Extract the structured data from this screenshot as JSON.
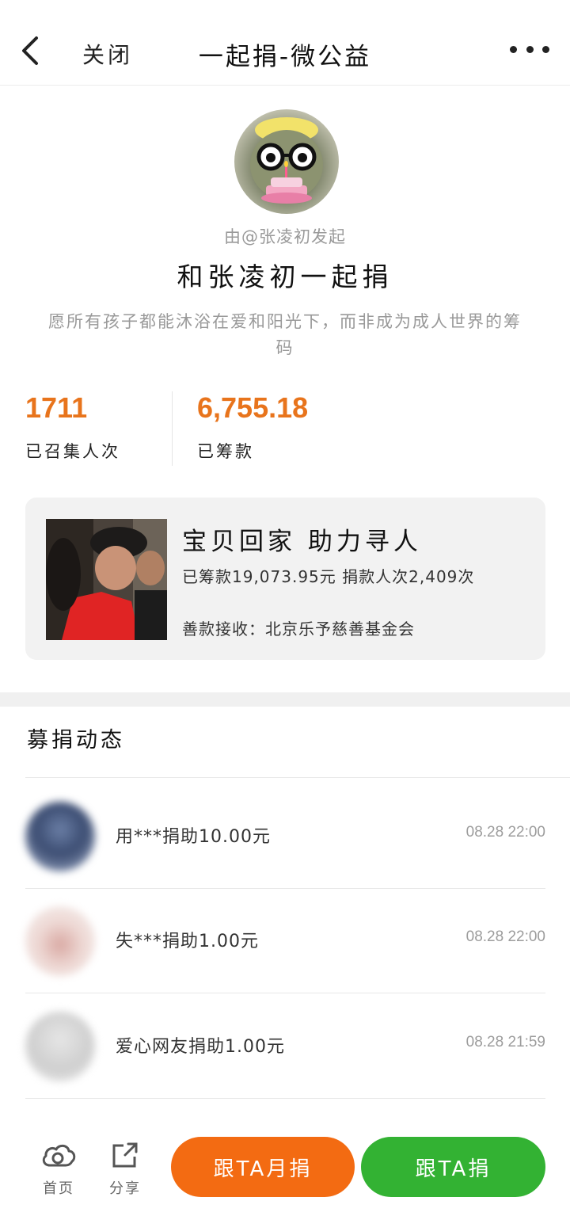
{
  "topbar": {
    "close_label": "关闭",
    "title": "一起捐-微公益"
  },
  "header": {
    "starter": "由@张凌初发起",
    "title": "和张凌初一起捐",
    "description": "愿所有孩子都能沐浴在爱和阳光下，而非成为成人世界的筹码"
  },
  "stats": [
    {
      "value": "1711",
      "label": "已召集人次"
    },
    {
      "value": "6,755.18",
      "label": "已筹款"
    }
  ],
  "project": {
    "name": "宝贝回家 助力寻人",
    "stats": "已筹款19,073.95元  捐款人次2,409次",
    "receiver": "善款接收：北京乐予慈善基金会"
  },
  "feed": {
    "title": "募捐动态",
    "items": [
      {
        "text": "用***捐助10.00元",
        "time": "08.28 22:00"
      },
      {
        "text": "失***捐助1.00元",
        "time": "08.28 22:00"
      },
      {
        "text": "爱心网友捐助1.00元",
        "time": "08.28 21:59"
      }
    ]
  },
  "bottombar": {
    "home_label": "首页",
    "share_label": "分享",
    "monthly_button": "跟TA月捐",
    "donate_button": "跟TA捐"
  },
  "colors": {
    "accent_orange": "#f36b12",
    "stat_orange": "#e8741c",
    "accent_green": "#33b233"
  }
}
